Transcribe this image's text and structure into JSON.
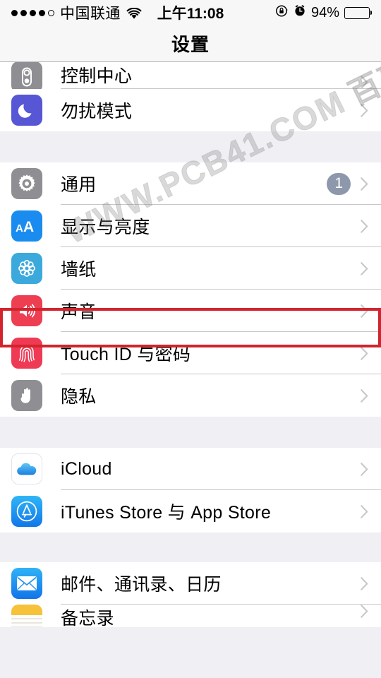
{
  "status_bar": {
    "signal_dots_filled": 4,
    "signal_dots_total": 5,
    "carrier": "中国联通",
    "wifi_icon": "wifi-icon",
    "time": "上午11:08",
    "rotation_lock_icon": "rotation-lock-icon",
    "alarm_icon": "alarm-clock-icon",
    "battery_percent": "94%",
    "battery_level": 94
  },
  "nav": {
    "title": "设置"
  },
  "watermark": {
    "text": "WWW.PCB41.COM",
    "text_cn": "百事网"
  },
  "annotation": {
    "color": "#d3232c",
    "target_row": "sounds"
  },
  "groups": [
    {
      "name": "group-controls",
      "rows": [
        {
          "id": "control-center",
          "label": "控制中心",
          "icon": "control-center-icon",
          "icon_bg": "#8e8e93",
          "clipped": "top"
        },
        {
          "id": "do-not-disturb",
          "label": "勿扰模式",
          "icon": "moon-icon",
          "icon_bg": "#5756d5"
        }
      ]
    },
    {
      "name": "group-device",
      "rows": [
        {
          "id": "general",
          "label": "通用",
          "icon": "gear-icon",
          "icon_bg": "#8e8e93",
          "badge": "1"
        },
        {
          "id": "display-brightness",
          "label": "显示与亮度",
          "icon": "aa-text-icon",
          "icon_bg": "#1a8cf0"
        },
        {
          "id": "wallpaper",
          "label": "墙纸",
          "icon": "flower-icon",
          "icon_bg": "#3ba9dc"
        },
        {
          "id": "sounds",
          "label": "声音",
          "icon": "speaker-icon",
          "icon_bg": "#ee3e52",
          "highlighted": true
        },
        {
          "id": "touch-id-passcode",
          "label": "Touch ID 与密码",
          "icon": "fingerprint-icon",
          "icon_bg": "#ef3a55"
        },
        {
          "id": "privacy",
          "label": "隐私",
          "icon": "hand-icon",
          "icon_bg": "#8e8e93"
        }
      ]
    },
    {
      "name": "group-accounts",
      "rows": [
        {
          "id": "icloud",
          "label": "iCloud",
          "icon": "cloud-icon",
          "icon_bg": "#ffffff"
        },
        {
          "id": "itunes-app-store",
          "label": "iTunes Store 与 App Store",
          "icon": "app-store-icon",
          "icon_bg": "#1b9df0"
        }
      ]
    },
    {
      "name": "group-apps",
      "rows": [
        {
          "id": "mail-contacts-calendars",
          "label": "邮件、通讯录、日历",
          "icon": "envelope-icon",
          "icon_bg": "#1c9ef5"
        },
        {
          "id": "notes",
          "label": "备忘录",
          "icon": "notes-icon",
          "icon_bg": "#f5c23a",
          "clipped": "bottom"
        }
      ]
    }
  ]
}
